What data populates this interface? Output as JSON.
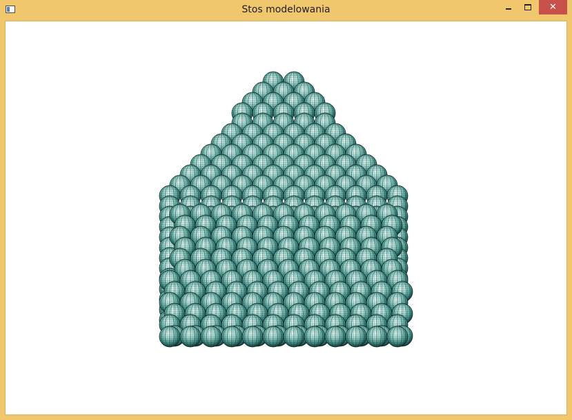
{
  "window": {
    "title": "Stos modelowania",
    "close_glyph": "✕",
    "icons": {
      "app": "window-app-icon",
      "minimize": "minimize-icon",
      "maximize": "maximize-icon",
      "close": "close-icon"
    },
    "colors": {
      "frame": "#f1c76d",
      "close_button": "#c7504b",
      "client_background": "#ffffff"
    }
  },
  "scene": {
    "description_type": "3d-viewport",
    "object": "stacked-spheres-pyramid",
    "sphere_colors": {
      "fill": "#9fd8cf",
      "shade": "#2f6f68",
      "wire": "#0c2a28"
    }
  }
}
